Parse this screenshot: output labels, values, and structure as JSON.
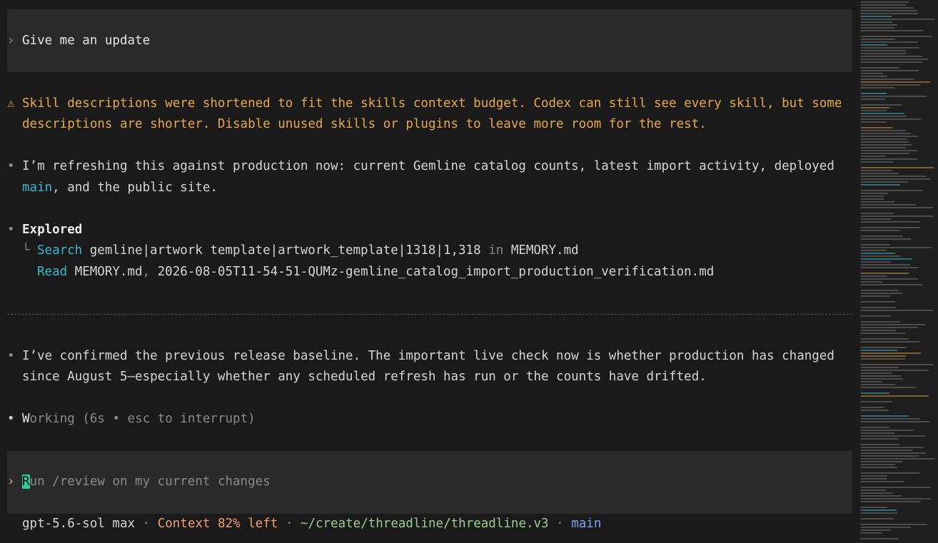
{
  "prompt_prev": {
    "marker": "›",
    "text": "Give me an update"
  },
  "warning": {
    "icon": "⚠",
    "line1": "Skill descriptions were shortened to fit the skills context budget. Codex can still see every skill, but some",
    "line2": "descriptions are shorter. Disable unused skills or plugins to leave more room for the rest."
  },
  "msg1": {
    "bullet": "•",
    "line1": "I’m refreshing this against production now: current Gemline catalog counts, latest import activity, deployed",
    "line2_code": "main",
    "line2_rest": ", and the public site."
  },
  "explored": {
    "bullet": "•",
    "title": "Explored",
    "tree": "└",
    "search_label": "Search",
    "search_query": "gemline|artwork template|artwork_template|1318|1,318",
    "search_in": "in",
    "search_file": "MEMORY.md",
    "read_label": "Read",
    "read_file1": "MEMORY.md",
    "read_sep": ",",
    "read_file2": "2026-08-05T11-54-51-QUMz-gemline_catalog_import_production_verification.md"
  },
  "msg2": {
    "bullet": "•",
    "line1": "I’ve confirmed the previous release baseline. The important live check now is whether production has changed",
    "line2": "since August 5—especially whether any scheduled refresh has run or the counts have drifted."
  },
  "working": {
    "bullet": "•",
    "w1": "W",
    "w2": "orking",
    "detail": "(6s • esc to interrupt)"
  },
  "composer": {
    "marker": "›",
    "cursor_char": "R",
    "placeholder_rest": "un /review on my current changes"
  },
  "footer": {
    "model": "gpt-5.6-sol max",
    "sep": "·",
    "context": "Context 82% left",
    "path": "~/create/threadline/threadline.v3",
    "branch": "main"
  }
}
